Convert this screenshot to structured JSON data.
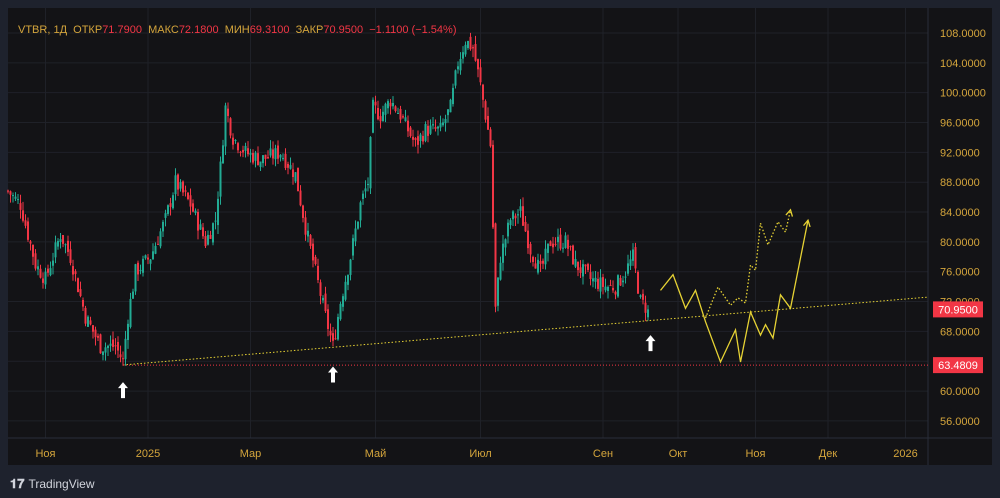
{
  "header": {
    "symbol": "VTBR, 1Д",
    "open_label": "ОТКР",
    "open": "71.7900",
    "high_label": "МАКС",
    "high": "72.1800",
    "low_label": "МИН",
    "low": "69.3100",
    "close_label": "ЗАКР",
    "close": "70.9500",
    "change": "−1.1100 (−1.54%)"
  },
  "brand": "TradingView",
  "colors": {
    "up": "#22ab94",
    "down": "#f23645",
    "axis": "#d4a53c",
    "forecast": "#e6d234"
  },
  "chart_data": {
    "type": "candlestick",
    "xlim": [
      0,
      368
    ],
    "ylim": [
      54.5,
      109
    ],
    "y_ticks": [
      56,
      60,
      64,
      68,
      72,
      76,
      80,
      84,
      88,
      92,
      96,
      100,
      104,
      108
    ],
    "x_ticks": [
      {
        "x": 15,
        "label": "Ноя"
      },
      {
        "x": 56,
        "label": "2025"
      },
      {
        "x": 97,
        "label": "Мар"
      },
      {
        "x": 147,
        "label": "Май"
      },
      {
        "x": 189,
        "label": "Июл"
      },
      {
        "x": 238,
        "label": "Сен"
      },
      {
        "x": 268,
        "label": "Окт"
      },
      {
        "x": 299,
        "label": "Ноя"
      },
      {
        "x": 328,
        "label": "Дек"
      },
      {
        "x": 359,
        "label": "2026"
      }
    ],
    "price_path": [
      [
        0,
        86.8
      ],
      [
        5,
        85
      ],
      [
        11,
        77
      ],
      [
        15,
        75
      ],
      [
        21,
        81
      ],
      [
        25,
        78
      ],
      [
        31,
        70
      ],
      [
        37,
        66
      ],
      [
        43,
        66
      ],
      [
        46,
        64
      ],
      [
        48,
        70
      ],
      [
        51,
        76
      ],
      [
        57,
        78
      ],
      [
        63,
        83
      ],
      [
        67,
        88
      ],
      [
        73,
        85
      ],
      [
        79,
        80
      ],
      [
        83,
        83
      ],
      [
        85,
        90
      ],
      [
        87,
        98
      ],
      [
        90,
        94
      ],
      [
        95,
        92
      ],
      [
        101,
        91
      ],
      [
        109,
        92
      ],
      [
        115,
        89
      ],
      [
        119,
        82
      ],
      [
        123,
        76
      ],
      [
        127,
        70
      ],
      [
        130,
        66
      ],
      [
        133,
        72
      ],
      [
        137,
        78
      ],
      [
        141,
        85
      ],
      [
        144,
        88
      ],
      [
        146,
        98
      ],
      [
        149,
        97
      ],
      [
        153,
        99
      ],
      [
        157,
        97
      ],
      [
        163,
        93
      ],
      [
        167,
        95
      ],
      [
        173,
        95
      ],
      [
        177,
        98
      ],
      [
        180,
        104
      ],
      [
        183,
        107
      ],
      [
        186,
        106
      ],
      [
        189,
        101
      ],
      [
        193,
        93
      ],
      [
        195,
        71
      ],
      [
        197,
        78
      ],
      [
        201,
        83
      ],
      [
        205,
        84
      ],
      [
        209,
        79
      ],
      [
        213,
        76
      ],
      [
        217,
        80
      ],
      [
        223,
        80
      ],
      [
        227,
        77
      ],
      [
        233,
        75
      ],
      [
        239,
        74
      ],
      [
        243,
        74
      ],
      [
        247,
        76
      ],
      [
        250,
        78
      ],
      [
        253,
        72
      ],
      [
        256,
        70.95
      ]
    ],
    "support_line": [
      [
        46,
        63.5
      ],
      [
        368,
        72.6
      ]
    ],
    "level_line": {
      "price": 63.4809,
      "from": 46,
      "label": "63.4809"
    },
    "last_price": {
      "price": 70.95,
      "label": "70.9500"
    },
    "forecast_solid": [
      [
        261,
        73.5
      ],
      [
        266,
        75.6
      ],
      [
        271,
        71.1
      ],
      [
        275,
        73.5
      ],
      [
        279,
        69.3
      ],
      [
        285,
        63.9
      ],
      [
        291,
        68.2
      ],
      [
        293,
        63.9
      ],
      [
        297,
        70.6
      ],
      [
        301,
        67.5
      ],
      [
        303,
        68.9
      ],
      [
        306,
        67.1
      ],
      [
        309,
        72.9
      ],
      [
        313,
        71.1
      ],
      [
        320,
        82.9
      ]
    ],
    "forecast_dotted": [
      [
        279,
        69.8
      ],
      [
        284,
        73.95
      ],
      [
        289,
        71.5
      ],
      [
        292,
        72.5
      ],
      [
        295,
        71.8
      ],
      [
        297,
        76.9
      ],
      [
        299,
        76.2
      ],
      [
        301,
        82.5
      ],
      [
        304,
        79.6
      ],
      [
        308,
        82.7
      ],
      [
        311,
        81.3
      ],
      [
        313,
        84.3
      ]
    ],
    "arrows": [
      [
        46,
        61.2
      ],
      [
        130,
        63.3
      ],
      [
        257,
        67.5
      ]
    ]
  }
}
